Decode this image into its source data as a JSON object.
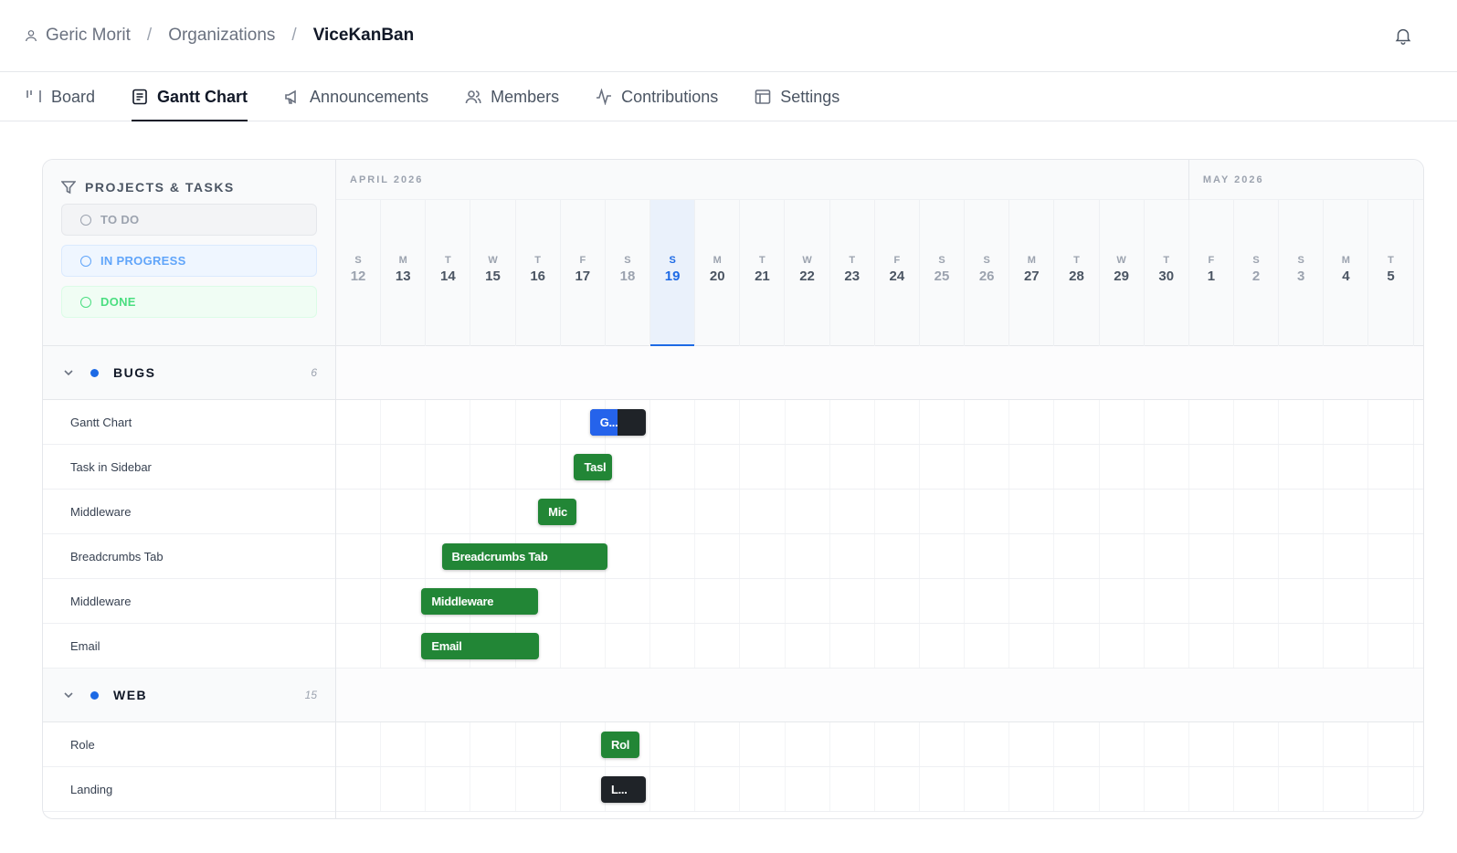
{
  "breadcrumb": {
    "user": "Geric Morit",
    "org": "Organizations",
    "project": "ViceKanBan",
    "sep": "/"
  },
  "icons": {
    "user": "user-icon",
    "bell": "bell-icon",
    "filter": "filter-icon",
    "chevron": "chevron-down-icon"
  },
  "tabs": [
    {
      "label": "Board",
      "icon": "board-icon"
    },
    {
      "label": "Gantt Chart",
      "icon": "document-icon",
      "active": true
    },
    {
      "label": "Announcements",
      "icon": "megaphone-icon"
    },
    {
      "label": "Members",
      "icon": "users-icon"
    },
    {
      "label": "Contributions",
      "icon": "activity-icon"
    },
    {
      "label": "Settings",
      "icon": "layout-icon"
    }
  ],
  "panel": {
    "title": "PROJECTS & TASKS",
    "statuses": [
      "TO DO",
      "IN PROGRESS",
      "DONE"
    ]
  },
  "colors": {
    "accent": "#1d6ae5",
    "done": "#228636",
    "dark": "#1f2328",
    "progress": "#2563eb"
  },
  "timeline": {
    "months": [
      {
        "label": "APRIL 2026",
        "days": 19
      },
      {
        "label": "MAY 2026",
        "days": 5
      }
    ],
    "days": [
      {
        "dw": "S",
        "dn": "12",
        "weekend": true
      },
      {
        "dw": "M",
        "dn": "13"
      },
      {
        "dw": "T",
        "dn": "14"
      },
      {
        "dw": "W",
        "dn": "15"
      },
      {
        "dw": "T",
        "dn": "16"
      },
      {
        "dw": "F",
        "dn": "17"
      },
      {
        "dw": "S",
        "dn": "18",
        "weekend": true
      },
      {
        "dw": "S",
        "dn": "19",
        "weekend": true,
        "today": true
      },
      {
        "dw": "M",
        "dn": "20"
      },
      {
        "dw": "T",
        "dn": "21"
      },
      {
        "dw": "W",
        "dn": "22"
      },
      {
        "dw": "T",
        "dn": "23"
      },
      {
        "dw": "F",
        "dn": "24"
      },
      {
        "dw": "S",
        "dn": "25",
        "weekend": true
      },
      {
        "dw": "S",
        "dn": "26",
        "weekend": true
      },
      {
        "dw": "M",
        "dn": "27"
      },
      {
        "dw": "T",
        "dn": "28"
      },
      {
        "dw": "W",
        "dn": "29"
      },
      {
        "dw": "T",
        "dn": "30"
      },
      {
        "dw": "F",
        "dn": "1"
      },
      {
        "dw": "S",
        "dn": "2",
        "weekend": true
      },
      {
        "dw": "S",
        "dn": "3",
        "weekend": true
      },
      {
        "dw": "M",
        "dn": "4"
      },
      {
        "dw": "T",
        "dn": "5"
      }
    ]
  },
  "groups": [
    {
      "name": "BUGS",
      "count": "6",
      "tasks": [
        {
          "name": "Gantt Chart",
          "bar_label": "G...",
          "start_day": 5.65,
          "end_day": 6.9,
          "style": "split",
          "progress": 0.5
        },
        {
          "name": "Task in Sidebar",
          "bar_label": "Tasl",
          "start_day": 5.3,
          "end_day": 6.15,
          "style": "done"
        },
        {
          "name": "Middleware",
          "bar_label": "Mic",
          "start_day": 4.5,
          "end_day": 5.35,
          "style": "done"
        },
        {
          "name": "Breadcrumbs Tab",
          "bar_label": "Breadcrumbs Tab",
          "start_day": 2.35,
          "end_day": 6.05,
          "style": "done"
        },
        {
          "name": "Middleware",
          "bar_label": "Middleware",
          "start_day": 1.9,
          "end_day": 4.5,
          "style": "done"
        },
        {
          "name": "Email",
          "bar_label": "Email",
          "start_day": 1.9,
          "end_day": 4.52,
          "style": "done"
        }
      ]
    },
    {
      "name": "WEB",
      "count": "15",
      "tasks": [
        {
          "name": "Role",
          "bar_label": "Rol",
          "start_day": 5.9,
          "end_day": 6.75,
          "style": "done"
        },
        {
          "name": "Landing",
          "bar_label": "L...",
          "start_day": 5.9,
          "end_day": 6.9,
          "style": "dark"
        }
      ]
    }
  ]
}
